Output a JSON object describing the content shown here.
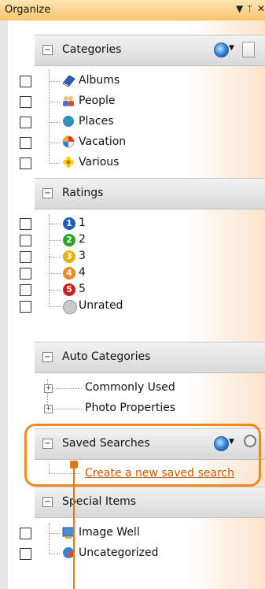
{
  "titlebar": {
    "title": "Organize",
    "menu_glyph": "▼",
    "pin_glyph": "ᛘ",
    "close_glyph": "✕"
  },
  "sections": {
    "categories": {
      "label": "Categories",
      "items": [
        {
          "label": "Albums",
          "icon": "album-icon"
        },
        {
          "label": "People",
          "icon": "people-icon"
        },
        {
          "label": "Places",
          "icon": "globe-icon"
        },
        {
          "label": "Vacation",
          "icon": "beach-ball-icon"
        },
        {
          "label": "Various",
          "icon": "flower-icon"
        }
      ]
    },
    "ratings": {
      "label": "Ratings",
      "items": [
        {
          "label": "1",
          "badge": "1",
          "color": "#1b5fc5"
        },
        {
          "label": "2",
          "badge": "2",
          "color": "#29a329"
        },
        {
          "label": "3",
          "badge": "3",
          "color": "#e0b400"
        },
        {
          "label": "4",
          "badge": "4",
          "color": "#f08a1e"
        },
        {
          "label": "5",
          "badge": "5",
          "color": "#d21f1f"
        },
        {
          "label": "Unrated",
          "badge": "",
          "color": "#c9c9c9"
        }
      ]
    },
    "auto_categories": {
      "label": "Auto Categories",
      "items": [
        {
          "label": "Commonly Used"
        },
        {
          "label": "Photo Properties"
        }
      ]
    },
    "saved_searches": {
      "label": "Saved Searches",
      "link": "Create a new saved search"
    },
    "special_items": {
      "label": "Special Items",
      "items": [
        {
          "label": "Image Well",
          "icon": "image-well-icon"
        },
        {
          "label": "Uncategorized",
          "icon": "uncategorized-icon"
        }
      ]
    }
  },
  "colors": {
    "accent": "#f08a1e",
    "titlebar": "#f7c56b"
  }
}
